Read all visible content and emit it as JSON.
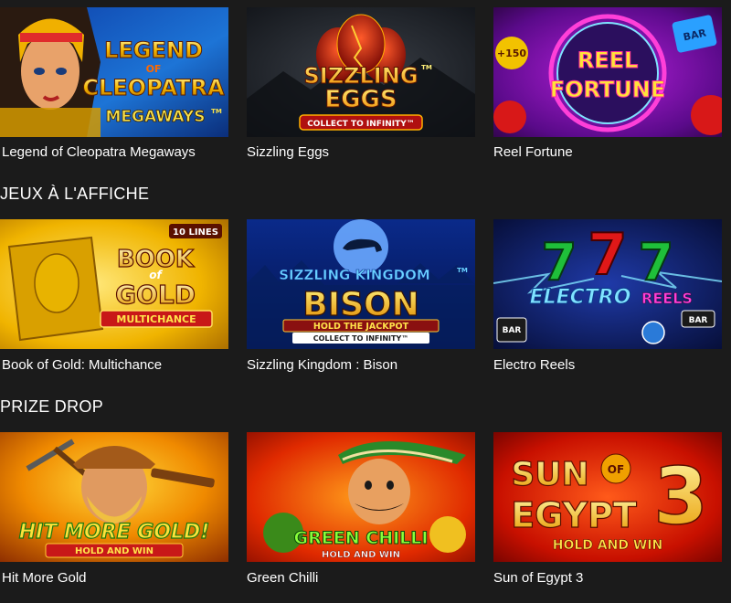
{
  "colors": {
    "background": "#1b1b1b",
    "text": "#ffffff"
  },
  "sections": [
    {
      "heading": "",
      "games": [
        {
          "title": "Legend of Cleopatra Megaways",
          "art": {
            "line1": "LEGEND",
            "of": "OF",
            "line2": "CLEOPATRA",
            "line3": "MEGAWAYS",
            "tm": "TM"
          }
        },
        {
          "title": "Sizzling Eggs",
          "art": {
            "line1": "SIZZLING",
            "line2": "EGGS",
            "tm": "TM",
            "banner": "COLLECT TO INFINITY™"
          }
        },
        {
          "title": "Reel Fortune",
          "art": {
            "line1": "REEL",
            "line2": "FORTUNE",
            "badge": "+150",
            "bar": "BAR"
          }
        }
      ]
    },
    {
      "heading": "JEUX À L'AFFICHE",
      "games": [
        {
          "title": "Book of Gold: Multichance",
          "art": {
            "lines": "10 LINES",
            "line1": "BOOK",
            "of": "of",
            "line2": "GOLD",
            "banner": "MULTICHANCE"
          }
        },
        {
          "title": "Sizzling Kingdom : Bison",
          "art": {
            "line1": "SIZZLING KINGDOM",
            "tm": "TM",
            "line2": "BISON",
            "banner1": "HOLD THE JACKPOT",
            "banner2": "COLLECT TO INFINITY™"
          }
        },
        {
          "title": "Electro Reels",
          "art": {
            "line1": "ELECTRO",
            "line2": "REELS",
            "seven": "7",
            "bar": "BAR"
          }
        }
      ]
    },
    {
      "heading": "PRIZE DROP",
      "games": [
        {
          "title": "Hit More Gold",
          "art": {
            "line1": "HIT MORE GOLD!",
            "banner": "HOLD AND WIN"
          }
        },
        {
          "title": "Green Chilli",
          "art": {
            "line1": "GREEN CHILLI",
            "banner": "HOLD AND WIN"
          }
        },
        {
          "title": "Sun of Egypt 3",
          "art": {
            "line1": "SUN",
            "of": "OF",
            "line2": "EGYPT",
            "num": "3",
            "banner": "HOLD AND WIN"
          }
        }
      ]
    }
  ]
}
